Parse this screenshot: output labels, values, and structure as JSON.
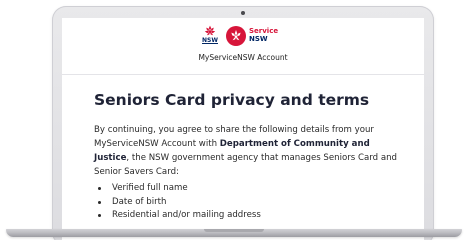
{
  "header": {
    "nsw_logo_text": "NSW",
    "service_nsw_line1": "Service",
    "service_nsw_line2": "NSW",
    "account_label": "MyServiceNSW Account"
  },
  "main": {
    "title": "Seniors Card privacy and terms",
    "intro_prefix": "By continuing, you agree to share the following details from your MyServiceNSW Account with ",
    "intro_agency": "Department of Community and Justice",
    "intro_suffix": ", the NSW government agency that manages Seniors Card and Senior Savers Card:",
    "details": [
      "Verified full name",
      "Date of birth",
      "Residential and/or mailing address"
    ]
  },
  "colors": {
    "nsw_red": "#d7153a",
    "nsw_navy": "#002664",
    "title": "#1f2336"
  },
  "icons": {
    "nsw_logo": "waratah-icon",
    "service_nsw_logo": "service-nsw-logo-icon"
  }
}
